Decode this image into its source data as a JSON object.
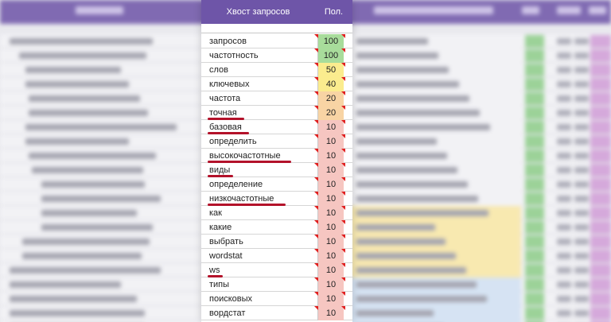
{
  "header": {
    "tail_col": "Хвост запросов",
    "pop_col": "Пол."
  },
  "colors": {
    "header": "#6e55a8",
    "green": "#a8dc9b",
    "yellow": "#fbec8e",
    "orange": "#f8d4a4",
    "red": "#f6c6c1",
    "underline": "#b3122a"
  },
  "rows": [
    {
      "term": "запросов",
      "value": "100",
      "color": "#a8dc9b",
      "underlined": false
    },
    {
      "term": "частотность",
      "value": "100",
      "color": "#a8dc9b",
      "underlined": false
    },
    {
      "term": "слов",
      "value": "50",
      "color": "#fbec8e",
      "underlined": false
    },
    {
      "term": "ключевых",
      "value": "40",
      "color": "#fbec8e",
      "underlined": false
    },
    {
      "term": "частота",
      "value": "20",
      "color": "#f8d4a4",
      "underlined": false
    },
    {
      "term": "точная",
      "value": "20",
      "color": "#f8d4a4",
      "underlined": true
    },
    {
      "term": "базовая",
      "value": "10",
      "color": "#f6c6c1",
      "underlined": true
    },
    {
      "term": "определить",
      "value": "10",
      "color": "#f6c6c1",
      "underlined": false
    },
    {
      "term": "высокочастотные",
      "value": "10",
      "color": "#f6c6c1",
      "underlined": true
    },
    {
      "term": "виды",
      "value": "10",
      "color": "#f6c6c1",
      "underlined": true
    },
    {
      "term": "определение",
      "value": "10",
      "color": "#f6c6c1",
      "underlined": false
    },
    {
      "term": "низкочастотные",
      "value": "10",
      "color": "#f6c6c1",
      "underlined": true
    },
    {
      "term": "как",
      "value": "10",
      "color": "#f6c6c1",
      "underlined": false
    },
    {
      "term": "какие",
      "value": "10",
      "color": "#f6c6c1",
      "underlined": false
    },
    {
      "term": "выбрать",
      "value": "10",
      "color": "#f6c6c1",
      "underlined": false
    },
    {
      "term": "wordstat",
      "value": "10",
      "color": "#f6c6c1",
      "underlined": false
    },
    {
      "term": "ws",
      "value": "10",
      "color": "#f6c6c1",
      "underlined": true
    },
    {
      "term": "типы",
      "value": "10",
      "color": "#f6c6c1",
      "underlined": false
    },
    {
      "term": "поисковых",
      "value": "10",
      "color": "#f6c6c1",
      "underlined": false
    },
    {
      "term": "вордстат",
      "value": "10",
      "color": "#f6c6c1",
      "underlined": false
    }
  ]
}
